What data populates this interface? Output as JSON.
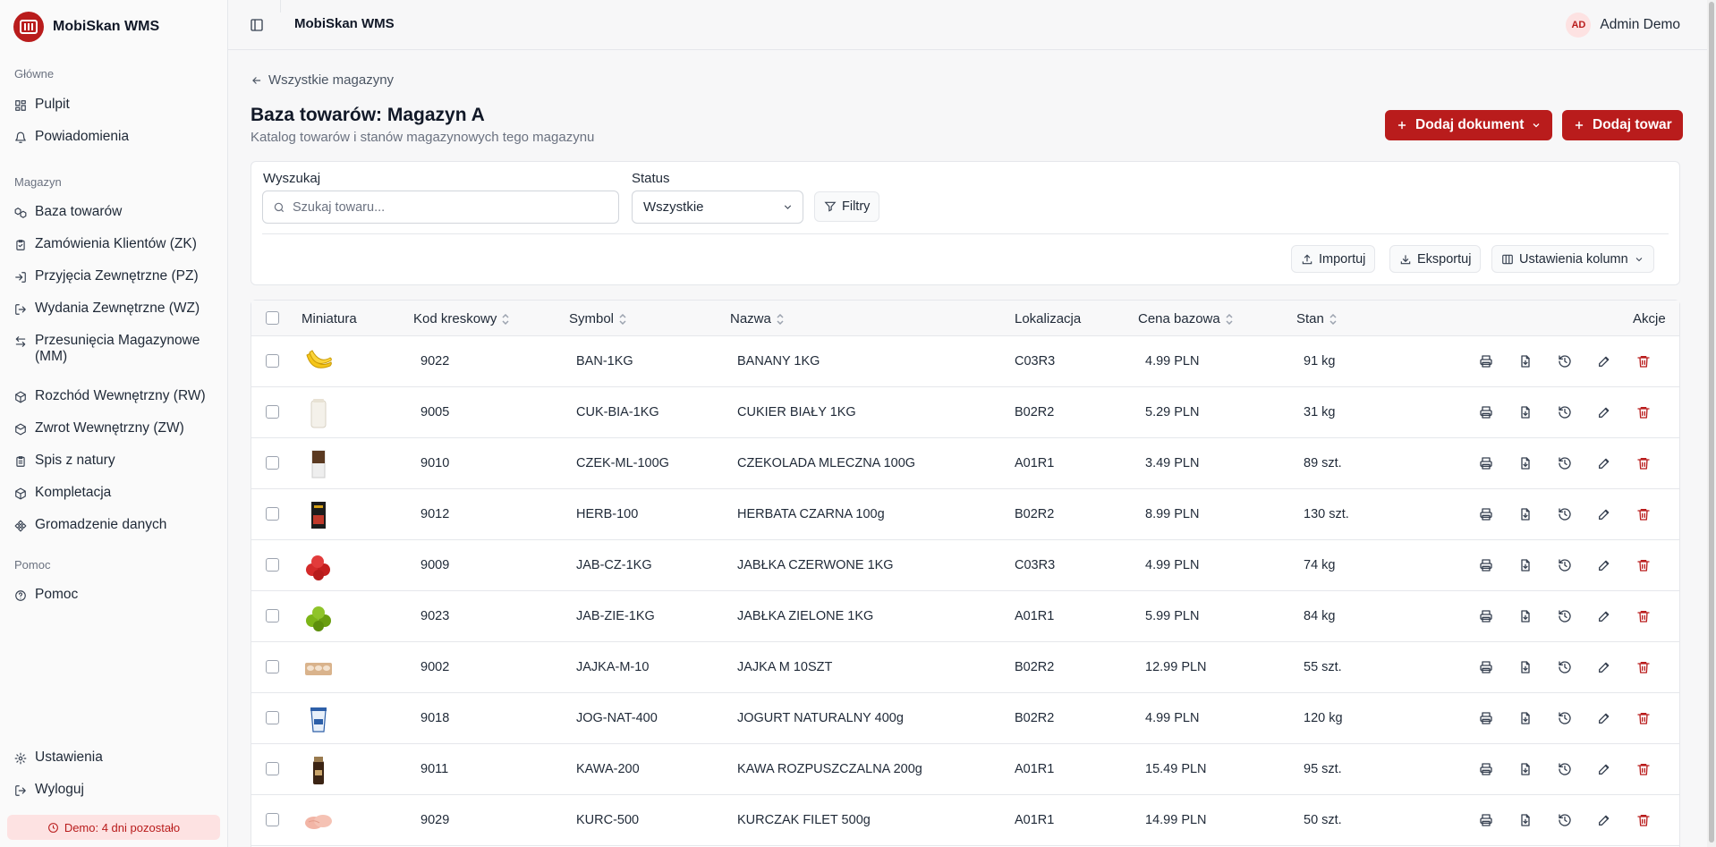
{
  "brand": {
    "name": "MobiSkan WMS"
  },
  "sidebar": {
    "sections": [
      {
        "title": "Główne",
        "items": [
          {
            "label": "Pulpit",
            "icon": "layout-dashboard-icon"
          },
          {
            "label": "Powiadomienia",
            "icon": "bell-icon"
          }
        ]
      },
      {
        "title": "Magazyn",
        "items": [
          {
            "label": "Baza towarów",
            "icon": "boxes-icon"
          },
          {
            "label": "Zamówienia Klientów (ZK)",
            "icon": "clipboard-check-icon"
          },
          {
            "label": "Przyjęcia Zewnętrzne (PZ)",
            "icon": "log-in-icon"
          },
          {
            "label": "Wydania Zewnętrzne (WZ)",
            "icon": "log-out-icon"
          },
          {
            "label": "Przesunięcia Magazynowe (MM)",
            "icon": "arrow-left-right-icon"
          },
          {
            "label": "Rozchód Wewnętrzny (RW)",
            "icon": "package-icon"
          },
          {
            "label": "Zwrot Wewnętrzny (ZW)",
            "icon": "package-return-icon"
          },
          {
            "label": "Spis z natury",
            "icon": "clipboard-list-icon"
          },
          {
            "label": "Kompletacja",
            "icon": "package-open-icon"
          },
          {
            "label": "Gromadzenie danych",
            "icon": "network-icon"
          }
        ]
      },
      {
        "title": "Pomoc",
        "items": [
          {
            "label": "Pomoc",
            "icon": "help-circle-icon"
          }
        ]
      }
    ],
    "footer": [
      {
        "label": "Ustawienia",
        "icon": "gear-icon"
      },
      {
        "label": "Wyloguj",
        "icon": "logout-icon"
      }
    ],
    "demo_badge": "Demo: 4 dni pozostało"
  },
  "topbar": {
    "title": "MobiSkan WMS",
    "user_initials": "AD",
    "user_name": "Admin Demo"
  },
  "page": {
    "back_link": "Wszystkie magazyny",
    "title": "Baza towarów: Magazyn A",
    "subtitle": "Katalog towarów i stanów magazynowych tego magazynu",
    "add_document": "Dodaj dokument",
    "add_product": "Dodaj towar"
  },
  "filters": {
    "search_label": "Wyszukaj",
    "search_placeholder": "Szukaj towaru...",
    "status_label": "Status",
    "status_value": "Wszystkie",
    "filters_button": "Filtry",
    "import": "Importuj",
    "export": "Eksportuj",
    "columns": "Ustawienia kolumn"
  },
  "table": {
    "headers": {
      "thumbnail": "Miniatura",
      "barcode": "Kod kreskowy",
      "symbol": "Symbol",
      "name": "Nazwa",
      "location": "Lokalizacja",
      "price": "Cena bazowa",
      "stock": "Stan",
      "actions": "Akcje"
    },
    "rows": [
      {
        "barcode": "9022",
        "symbol": "BAN-1KG",
        "name": "BANANY 1KG",
        "location": "C03R3",
        "price": "4.99 PLN",
        "stock": "91 kg",
        "thumb": "banana"
      },
      {
        "barcode": "9005",
        "symbol": "CUK-BIA-1KG",
        "name": "CUKIER BIAŁY 1KG",
        "location": "B02R2",
        "price": "5.29 PLN",
        "stock": "31 kg",
        "thumb": "sugar"
      },
      {
        "barcode": "9010",
        "symbol": "CZEK-ML-100G",
        "name": "CZEKOLADA MLECZNA 100G",
        "location": "A01R1",
        "price": "3.49 PLN",
        "stock": "89 szt.",
        "thumb": "chocolate"
      },
      {
        "barcode": "9012",
        "symbol": "HERB-100",
        "name": "HERBATA CZARNA 100g",
        "location": "B02R2",
        "price": "8.99 PLN",
        "stock": "130 szt.",
        "thumb": "tea"
      },
      {
        "barcode": "9009",
        "symbol": "JAB-CZ-1KG",
        "name": "JABŁKA CZERWONE 1KG",
        "location": "C03R3",
        "price": "4.99 PLN",
        "stock": "74 kg",
        "thumb": "red-apples"
      },
      {
        "barcode": "9023",
        "symbol": "JAB-ZIE-1KG",
        "name": "JABŁKA ZIELONE 1KG",
        "location": "A01R1",
        "price": "5.99 PLN",
        "stock": "84 kg",
        "thumb": "green-apples"
      },
      {
        "barcode": "9002",
        "symbol": "JAJKA-M-10",
        "name": "JAJKA M 10SZT",
        "location": "B02R2",
        "price": "12.99 PLN",
        "stock": "55 szt.",
        "thumb": "eggs"
      },
      {
        "barcode": "9018",
        "symbol": "JOG-NAT-400",
        "name": "JOGURT NATURALNY 400g",
        "location": "B02R2",
        "price": "4.99 PLN",
        "stock": "120 kg",
        "thumb": "yogurt"
      },
      {
        "barcode": "9011",
        "symbol": "KAWA-200",
        "name": "KAWA ROZPUSZCZALNA 200g",
        "location": "A01R1",
        "price": "15.49 PLN",
        "stock": "95 szt.",
        "thumb": "coffee"
      },
      {
        "barcode": "9029",
        "symbol": "KURC-500",
        "name": "KURCZAK FILET 500g",
        "location": "A01R1",
        "price": "14.99 PLN",
        "stock": "50 szt.",
        "thumb": "chicken"
      }
    ],
    "row_actions": [
      "print-icon",
      "file-icon",
      "history-icon",
      "edit-icon",
      "trash-icon"
    ]
  },
  "colors": {
    "accent": "#b91c1c",
    "accent_soft": "#fde2e2"
  }
}
